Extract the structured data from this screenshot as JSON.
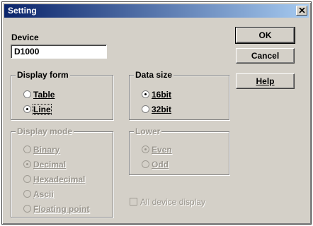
{
  "window": {
    "title": "Setting",
    "close_icon": "close-icon"
  },
  "device": {
    "label": "Device",
    "value": "D1000"
  },
  "buttons": {
    "ok": "OK",
    "cancel": "Cancel",
    "help": "Help"
  },
  "display_form": {
    "title": "Display form",
    "options": [
      {
        "label": "Table",
        "selected": false
      },
      {
        "label": "Line",
        "selected": true
      }
    ]
  },
  "data_size": {
    "title": "Data size",
    "options": [
      {
        "label": "16bit",
        "selected": true
      },
      {
        "label": "32bit",
        "selected": false
      }
    ]
  },
  "display_mode": {
    "title": "Display mode",
    "enabled": false,
    "options": [
      {
        "label": "Binary",
        "selected": false
      },
      {
        "label": "Decimal",
        "selected": true
      },
      {
        "label": "Hexadecimal",
        "selected": false
      },
      {
        "label": "Ascii",
        "selected": false
      },
      {
        "label": "Floating point",
        "selected": false
      }
    ]
  },
  "lower": {
    "title": "Lower",
    "enabled": false,
    "options": [
      {
        "label": "Even",
        "selected": true
      },
      {
        "label": "Odd",
        "selected": false
      }
    ]
  },
  "all_device_display": {
    "label": "All device display",
    "checked": false,
    "enabled": false
  }
}
